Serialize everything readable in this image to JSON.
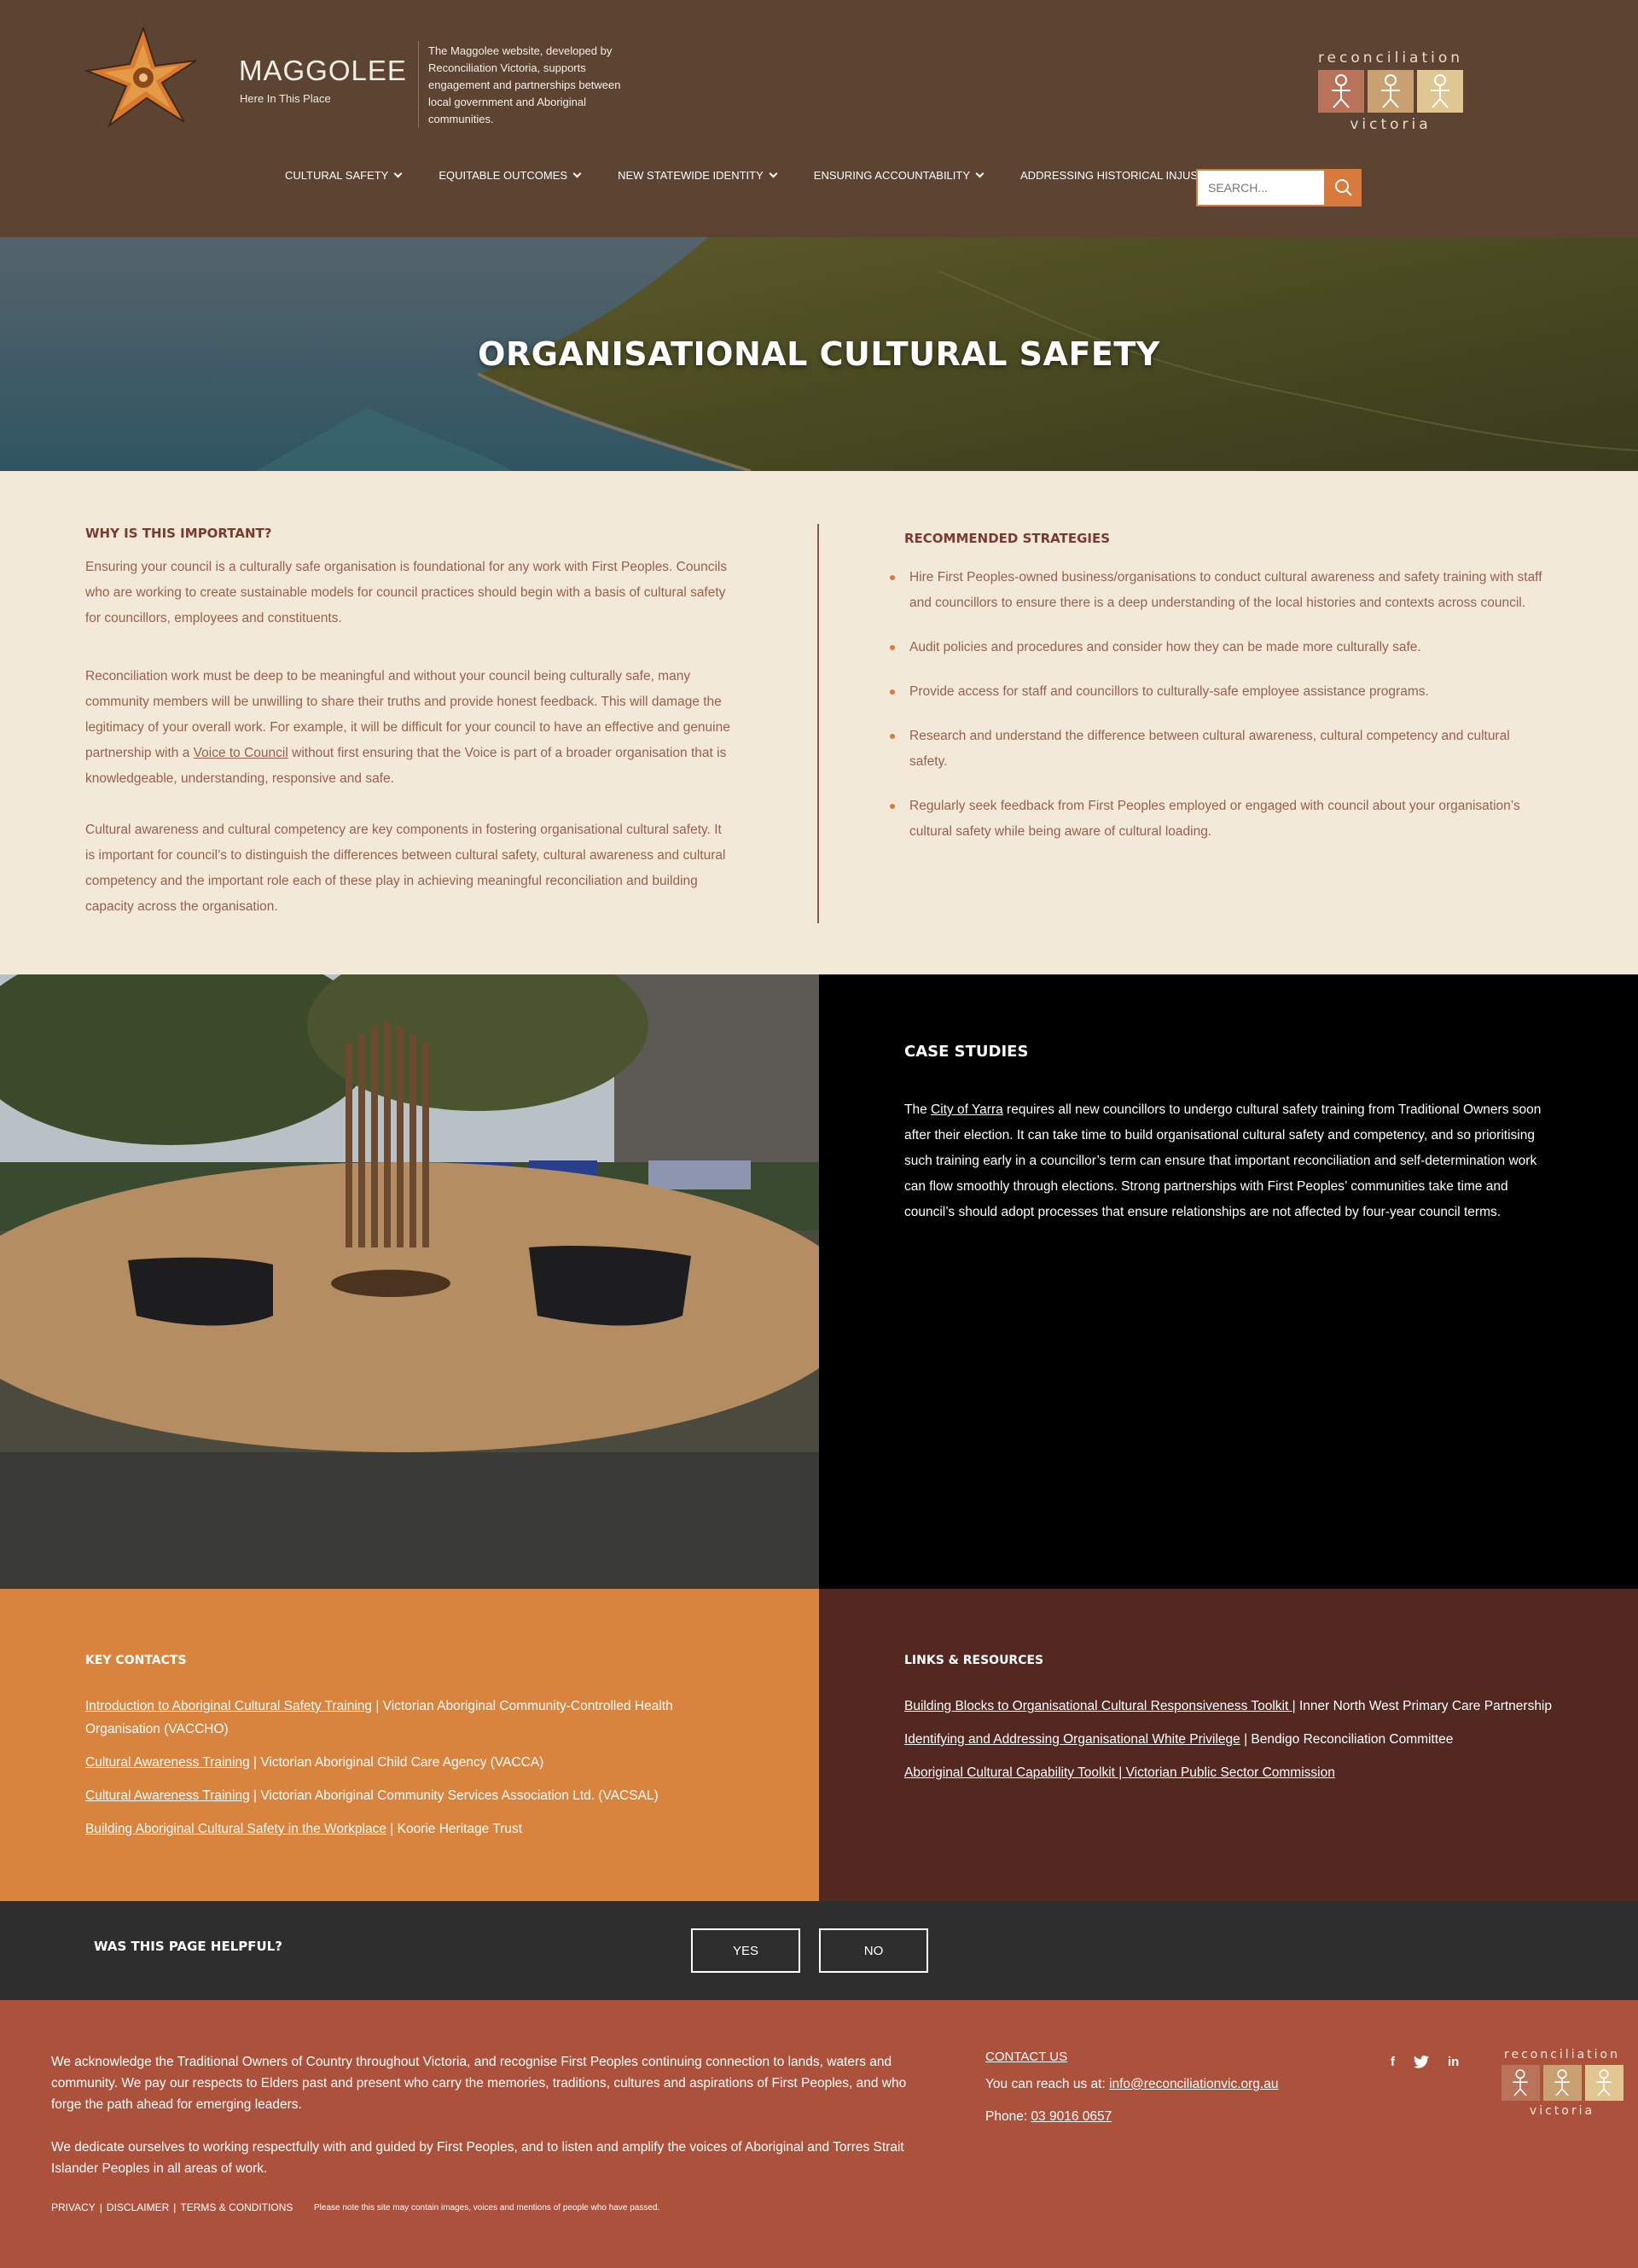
{
  "header": {
    "brand_name": "MAGGOLEE",
    "brand_tagline": "Here In This Place",
    "brand_description": "The Maggolee website, developed by Reconciliation Victoria, supports engagement and partnerships between local government and Aboriginal communities.",
    "rv_logo_top": "reconciliation",
    "rv_logo_bottom": "victoria",
    "search_placeholder": "SEARCH...",
    "nav": [
      {
        "label": "CULTURAL SAFETY"
      },
      {
        "label": "EQUITABLE OUTCOMES"
      },
      {
        "label": "NEW STATEWIDE IDENTITY"
      },
      {
        "label": "ENSURING ACCOUNTABILITY"
      },
      {
        "label": "ADDRESSING HISTORICAL INJUSTICE"
      }
    ],
    "accent_color": "#d87a3c"
  },
  "hero": {
    "title": "ORGANISATIONAL CULTURAL SAFETY"
  },
  "why": {
    "heading": "WHY IS THIS IMPORTANT?",
    "p1": "Ensuring your council is a culturally safe organisation is foundational for any work with First Peoples. Councils who are working to create sustainable models for council practices should begin with a basis of cultural safety for councillors, employees and constituents.",
    "p2_before": "Reconciliation work must be deep to be meaningful and without your council being culturally safe, many community members will be unwilling to share their truths and provide honest feedback. This will damage the legitimacy of your overall work. For example, it will be difficult for your council to have an effective and genuine partnership with a ",
    "p2_link": "Voice to Council",
    "p2_after": " without first ensuring that the Voice is part of a broader organisation that is knowledgeable, understanding, responsive and safe.",
    "p3": "Cultural awareness and cultural competency are key components in fostering organisational cultural safety. It is important for council’s to distinguish the differences between cultural safety, cultural awareness and cultural competency and the important role each of these play in achieving meaningful reconciliation and building capacity across the organisation."
  },
  "strategies": {
    "heading": "RECOMMENDED STRATEGIES",
    "items": [
      "Hire First Peoples-owned business/organisations to conduct cultural awareness and safety training with staff and councillors to ensure there is a deep understanding of the local histories and contexts across council.",
      "Audit policies and procedures and consider how they can be made more culturally safe.",
      "Provide access for staff and councillors to culturally-safe employee assistance programs.",
      "Research and understand the difference between cultural awareness, cultural competency and cultural safety.",
      "Regularly seek feedback from First Peoples employed or engaged with council about your organisation’s cultural safety while being aware of cultural loading."
    ]
  },
  "case_studies": {
    "heading": "CASE STUDIES",
    "text_before": "The ",
    "link": "City of Yarra",
    "text_after": " requires all new councillors to undergo cultural safety training from Traditional Owners soon after their election. It can take time to build organisational cultural safety and competency, and so prioritising such training early in a councillor’s term can ensure that important reconciliation and self-determination work can flow smoothly through elections. Strong partnerships with First Peoples’ communities take time and council’s should adopt processes that ensure relationships are not affected by four-year council terms."
  },
  "key_contacts": {
    "heading": "KEY CONTACTS",
    "items": [
      {
        "link": "Introduction to Aboriginal Cultural Safety Training",
        "rest": " | Victorian Aboriginal Community-Controlled Health Organisation (VACCHO)"
      },
      {
        "link": "Cultural Awareness Training",
        "rest": " | Victorian Aboriginal Child Care Agency (VACCA)"
      },
      {
        "link": "Cultural Awareness Training",
        "rest": " | Victorian Aboriginal Community Services Association Ltd. (VACSAL)"
      },
      {
        "link": "Building Aboriginal Cultural Safety in the Workplace",
        "rest": " | Koorie Heritage Trust"
      }
    ]
  },
  "links_resources": {
    "heading": "LINKS & RESOURCES",
    "items": [
      {
        "link": "Building Blocks to Organisational Cultural Responsiveness Toolkit |",
        "rest": " Inner North West Primary Care Partnership"
      },
      {
        "link": "Identifying and Addressing Organisational White Privilege",
        "rest": " | Bendigo Reconciliation Committee"
      },
      {
        "link": "Aboriginal Cultural Capability Toolkit | Victorian Public Sector Commission",
        "rest": ""
      }
    ]
  },
  "helpful": {
    "question": "WAS THIS PAGE HELPFUL?",
    "yes": "YES",
    "no": "NO"
  },
  "footer": {
    "ack_p1": "We acknowledge the Traditional Owners of Country throughout Victoria, and recognise First Peoples continuing connection to lands, waters and community. We pay our respects to Elders past and present who carry the memories, traditions, cultures and aspirations of First Peoples, and who forge the path ahead for emerging leaders.",
    "ack_p2": "We dedicate ourselves to working respectfully with and guided by First Peoples, and to listen and amplify the voices of Aboriginal and Torres Strait Islander Peoples in all areas of work.",
    "privacy": "PRIVACY",
    "disclaimer": "DISCLAIMER",
    "terms": "TERMS & CONDITIONS",
    "sep": "|",
    "note": "Please note this site may contain images, voices and mentions of people who have passed.",
    "contact_heading": "CONTACT US",
    "reach_label": "You can reach us at: ",
    "email": "info@reconciliationvic.org.au",
    "phone_label": "Phone: ",
    "phone": "03 9016 0657",
    "social_facebook": "f",
    "social_twitter_icon": "twitter-icon",
    "social_linkedin": "in"
  }
}
